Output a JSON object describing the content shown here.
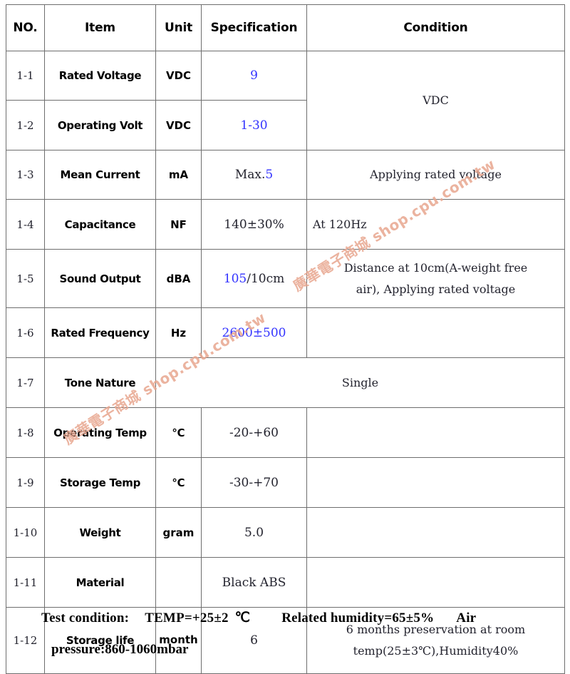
{
  "watermark": {
    "text": "廣華電子商城 shop.cpu.com.tw",
    "color": "#e8a68f"
  },
  "accent": {
    "blue": "#3333ff",
    "border": "#6e6e6e"
  },
  "table": {
    "headers": {
      "no": "NO.",
      "item": "Item",
      "unit": "Unit",
      "specification": "Specification",
      "condition": "Condition"
    },
    "rows": [
      {
        "no": "1-1",
        "item": "Rated Voltage",
        "unit": "VDC",
        "spec_blue": "9",
        "spec_black": "",
        "condition": "VDC"
      },
      {
        "no": "1-2",
        "item": "Operating Volt",
        "unit": "VDC",
        "spec_blue": "1-30",
        "spec_black": "",
        "condition": ""
      },
      {
        "no": "1-3",
        "item": "Mean Current",
        "unit": "mA",
        "spec_black": "Max.",
        "spec_blue": "5",
        "condition": "Applying rated voltage"
      },
      {
        "no": "1-4",
        "item": "Capacitance",
        "unit": "NF",
        "spec_black": "140±30%",
        "spec_blue": "",
        "condition": "At 120Hz"
      },
      {
        "no": "1-5",
        "item": "Sound Output",
        "unit": "dBA",
        "spec_blue": "105",
        "spec_black": "/10cm",
        "condition_line1": "Distance at 10cm(A-weight free",
        "condition_line2": "air), Applying rated voltage"
      },
      {
        "no": "1-6",
        "item": "Rated Frequency",
        "unit": "Hz",
        "spec_blue": "2600±500",
        "spec_black": "",
        "condition": ""
      },
      {
        "no": "1-7",
        "item": "Tone Nature",
        "merged_value": "Single"
      },
      {
        "no": "1-8",
        "item": "Operating Temp",
        "unit": "℃",
        "spec_black": "-20-+60",
        "spec_blue": "",
        "condition": ""
      },
      {
        "no": "1-9",
        "item": "Storage Temp",
        "unit": "℃",
        "spec_black": "-30-+70",
        "spec_blue": "",
        "condition": ""
      },
      {
        "no": "1-10",
        "item": "Weight",
        "unit": "gram",
        "spec_black": "5.0",
        "spec_blue": "",
        "condition": ""
      },
      {
        "no": "1-11",
        "item": "Material",
        "unit": "",
        "spec_black": "Black ABS",
        "spec_blue": "",
        "condition": ""
      },
      {
        "no": "1-12",
        "item": "Storage life",
        "unit": "month",
        "spec_black": "6",
        "spec_blue": "",
        "condition_line1": "6 months preservation at room",
        "condition_line2": "temp(25±3℃),Humidity40%"
      }
    ]
  },
  "footer": {
    "label": "Test  condition:",
    "temp": "TEMP=+25±2",
    "temp_unit": "℃",
    "humidity": "Related  humidity=65±5%",
    "air": "Air",
    "pressure": "pressure:860-1060mbar"
  }
}
